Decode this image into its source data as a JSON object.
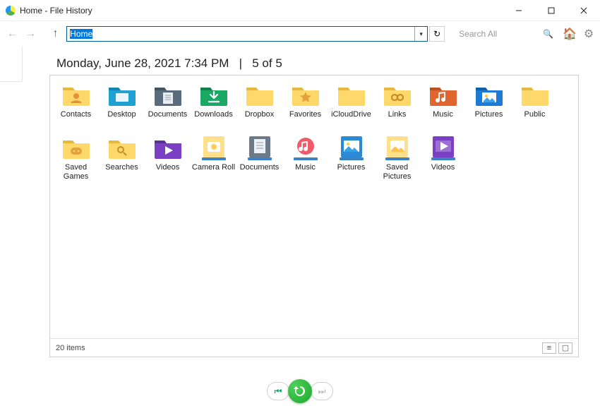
{
  "window": {
    "title": "Home - File History"
  },
  "toolbar": {
    "address": "Home",
    "search_placeholder": "Search All"
  },
  "header": {
    "date": "Monday, June 28, 2021 7:34 PM",
    "sep": "|",
    "position": "5 of 5"
  },
  "items": [
    {
      "label": "Contacts",
      "icon": "folder-contacts"
    },
    {
      "label": "Desktop",
      "icon": "folder-desktop"
    },
    {
      "label": "Documents",
      "icon": "folder-documents"
    },
    {
      "label": "Downloads",
      "icon": "folder-downloads"
    },
    {
      "label": "Dropbox",
      "icon": "folder"
    },
    {
      "label": "Favorites",
      "icon": "folder-favorites"
    },
    {
      "label": "iCloudDrive",
      "icon": "folder"
    },
    {
      "label": "Links",
      "icon": "folder-links"
    },
    {
      "label": "Music",
      "icon": "folder-music"
    },
    {
      "label": "Pictures",
      "icon": "folder-pictures"
    },
    {
      "label": "Public",
      "icon": "folder"
    },
    {
      "label": "Saved Games",
      "icon": "folder-games"
    },
    {
      "label": "Searches",
      "icon": "folder-searches"
    },
    {
      "label": "Videos",
      "icon": "folder-videos"
    },
    {
      "label": "Camera Roll",
      "icon": "lib-camera"
    },
    {
      "label": "Documents",
      "icon": "lib-documents"
    },
    {
      "label": "Music",
      "icon": "lib-music"
    },
    {
      "label": "Pictures",
      "icon": "lib-pictures"
    },
    {
      "label": "Saved Pictures",
      "icon": "lib-saved"
    },
    {
      "label": "Videos",
      "icon": "lib-videos"
    }
  ],
  "status": {
    "count": "20 items"
  }
}
